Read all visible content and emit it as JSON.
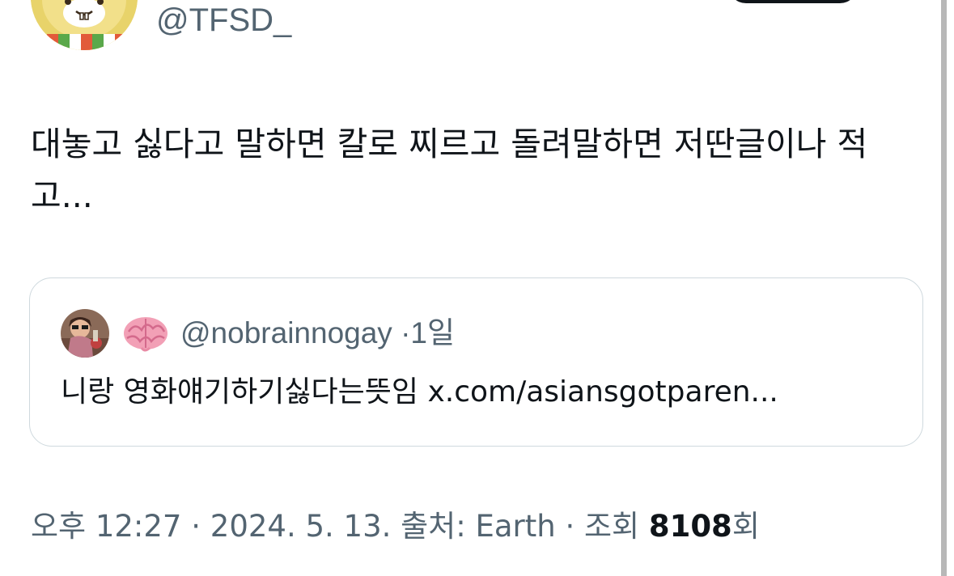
{
  "author": {
    "handle": "@TFSD_"
  },
  "tweet": {
    "text": "대놓고 싫다고 말하면 칼로 찌르고 돌려말하면 저딴글이나 적고..."
  },
  "quoted_tweet": {
    "handle": "@nobrainnogay",
    "separator": "·",
    "time": "1일",
    "text": "니랑 영화얘기하기싫다는뜻임 x.com/asiansgotparen..."
  },
  "meta": {
    "time": "오후 12:27",
    "separator1": " · ",
    "date": "2024. 5. 13.",
    "source_label": " 출처: ",
    "source": "Earth",
    "separator2": " · ",
    "views_label": "조회 ",
    "views_count": "8108",
    "views_suffix": "회"
  },
  "icons": {
    "author_avatar": "hamster-avatar-icon",
    "quote_avatar": "person-avatar-icon",
    "emoji": "brain-icon"
  },
  "colors": {
    "text_primary": "#0f1419",
    "text_secondary": "#536471",
    "border": "#cfd9de"
  }
}
